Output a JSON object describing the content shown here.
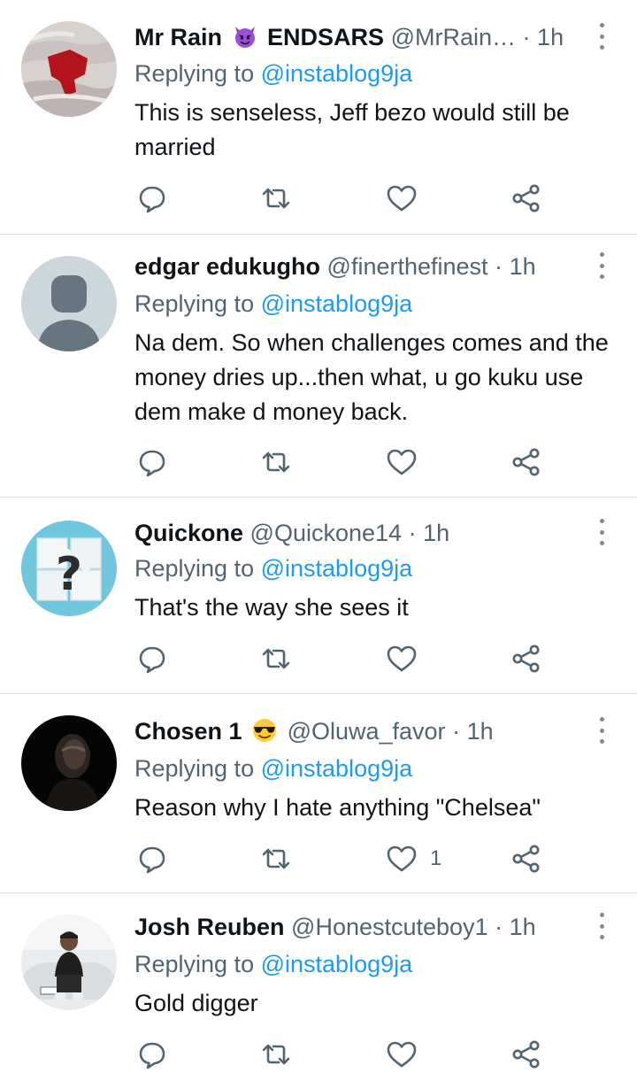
{
  "tweets": [
    {
      "name": "Mr Rain",
      "name_suffix": "ENDSARS",
      "emoji": "smiling-imp-emoji",
      "handle": "@MrRain…",
      "dot": "·",
      "time": "1h",
      "replying_prefix": "Replying to",
      "replying_to": "@instablog9ja",
      "text": "This is senseless, Jeff bezo would still be married",
      "likes": ""
    },
    {
      "name": "edgar edukugho",
      "handle": "@finerthefinest",
      "dot": "·",
      "time": "1h",
      "replying_prefix": "Replying to",
      "replying_to": "@instablog9ja",
      "text": "Na dem. So when challenges comes and the money dries up...then what, u go kuku use dem make d money back.",
      "likes": ""
    },
    {
      "name": "Quickone",
      "handle": "@Quickone14",
      "dot": "·",
      "time": "1h",
      "replying_prefix": "Replying to",
      "replying_to": "@instablog9ja",
      "text": "That's the way she sees it",
      "likes": ""
    },
    {
      "name": "Chosen 1",
      "emoji": "sunglasses-emoji",
      "handle": "@Oluwa_favor",
      "dot": "·",
      "time": "1h",
      "replying_prefix": "Replying to",
      "replying_to": "@instablog9ja",
      "text": "Reason why I hate anything \"Chelsea\"",
      "likes": "1"
    },
    {
      "name": "Josh Reuben",
      "handle": "@Honestcuteboy1",
      "dot": "·",
      "time": "1h",
      "replying_prefix": "Replying to",
      "replying_to": "@instablog9ja",
      "text": "Gold digger",
      "likes": ""
    }
  ],
  "colors": {
    "link": "#1d9bf0",
    "secondary_text": "#536471",
    "primary_text": "#0f1419",
    "divider": "#d9dee2"
  }
}
